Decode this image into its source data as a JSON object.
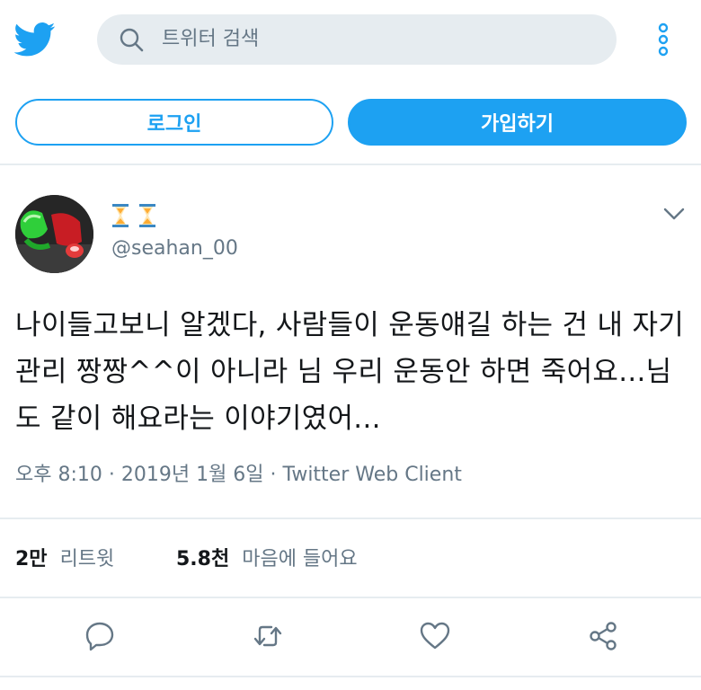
{
  "header": {
    "search_placeholder": "트위터 검색",
    "brand_color": "#1da1f2"
  },
  "auth": {
    "login_label": "로그인",
    "signup_label": "가입하기"
  },
  "tweet": {
    "display_name_icons": [
      "hourglass-icon",
      "hourglass-icon"
    ],
    "handle": "@seahan_00",
    "text": "나이들고보니 알겠다, 사람들이 운동얘길 하는 건 내 자기관리 짱짱^^이 아니라 님 우리 운동안 하면 죽어요...님도 같이 해요라는 이야기였어...",
    "meta": "오후 8:10 · 2019년 1월 6일 · Twitter Web Client"
  },
  "stats": {
    "retweets_count": "2만",
    "retweets_label": "리트윗",
    "likes_count": "5.8천",
    "likes_label": "마음에 들어요"
  },
  "actions": [
    "reply-icon",
    "retweet-icon",
    "like-icon",
    "share-icon"
  ]
}
